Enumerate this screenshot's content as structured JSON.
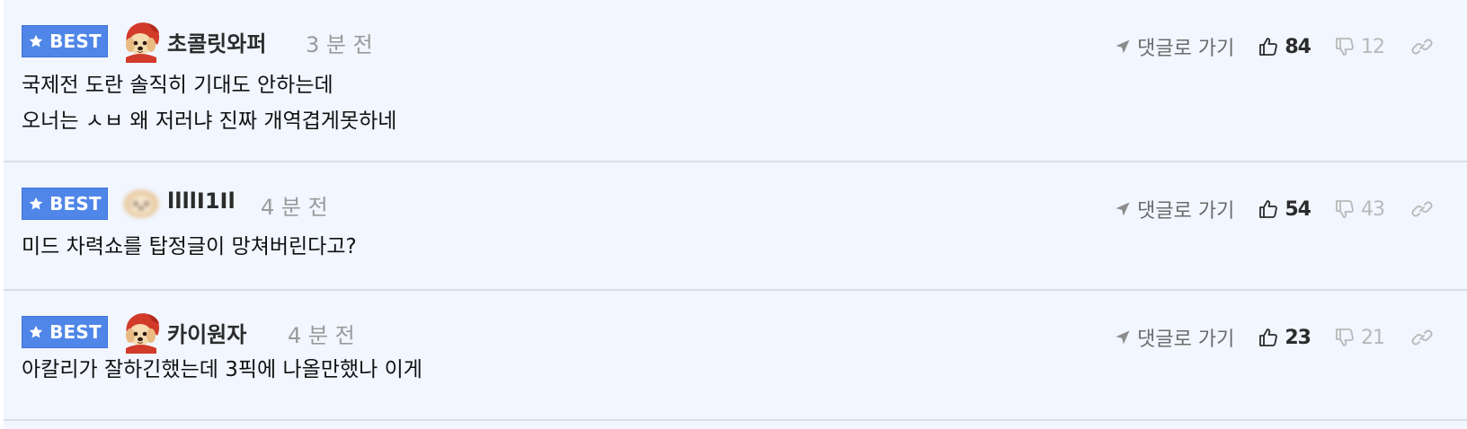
{
  "comments": [
    {
      "badge": "BEST",
      "nickname": "초콜릿와퍼",
      "time": "3 분 전",
      "avatar_icon": "dog-avatar-icon",
      "lines": [
        "국제전 도란 솔직히 기대도 안하는데",
        "오너는 ㅅㅂ 왜 저러냐 진짜 개역겹게못하네"
      ],
      "goto_label": "댓글로 가기",
      "upvotes": "84",
      "downvotes": "12"
    },
    {
      "badge": "BEST",
      "nickname": "llllI1Il",
      "time": "4 분 전",
      "avatar_icon": "blurred-avatar-icon",
      "lines": [
        "미드 차력쇼를 탑정글이 망쳐버린다고?"
      ],
      "goto_label": "댓글로 가기",
      "upvotes": "54",
      "downvotes": "43"
    },
    {
      "badge": "BEST",
      "nickname": "카이원자",
      "time": "4 분 전",
      "avatar_icon": "dog-avatar-icon",
      "lines": [
        "아칼리가 잘하긴했는데 3픽에 나올만했나 이게"
      ],
      "goto_label": "댓글로 가기",
      "upvotes": "23",
      "downvotes": "21"
    }
  ],
  "colors": {
    "background": "#f1f6ff",
    "badge": "#4f86e8",
    "divider": "#d9dfe8",
    "muted_text": "#9a9a9a"
  }
}
